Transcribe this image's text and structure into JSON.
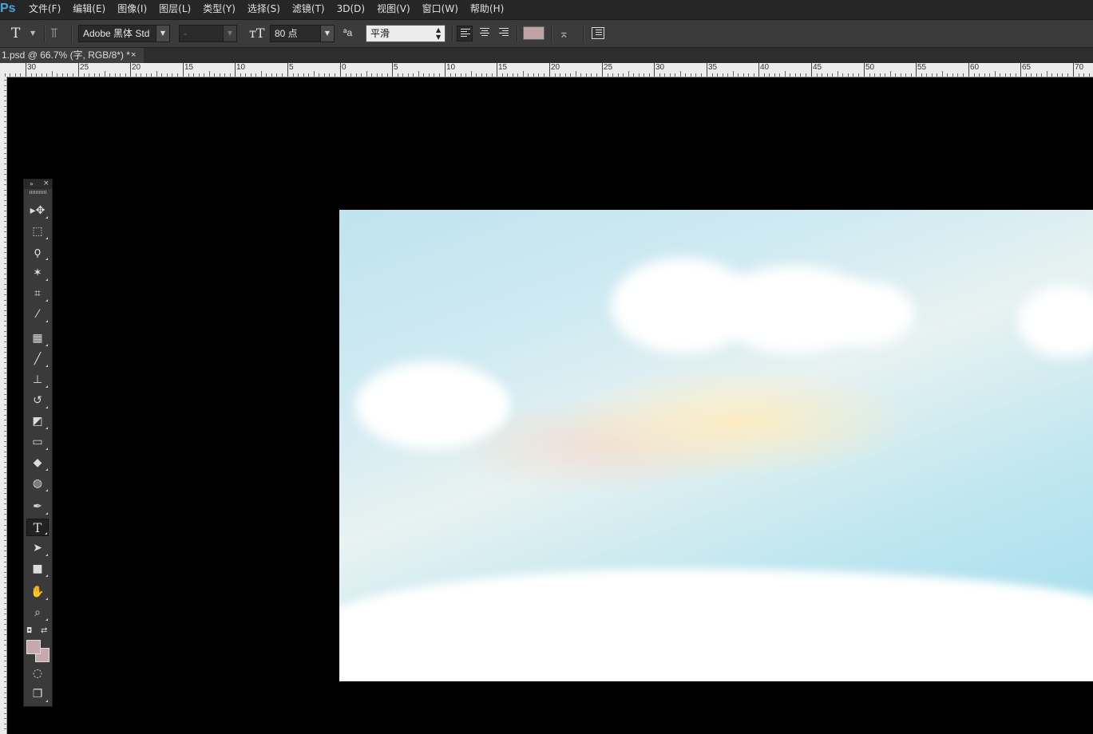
{
  "app": {
    "logo": "Ps"
  },
  "menu": [
    "文件(F)",
    "编辑(E)",
    "图像(I)",
    "图层(L)",
    "类型(Y)",
    "选择(S)",
    "滤镜(T)",
    "3D(D)",
    "视图(V)",
    "窗口(W)",
    "帮助(H)"
  ],
  "options": {
    "tool_glyph": "T",
    "font_family": "Adobe 黑体 Std",
    "font_style": "-",
    "font_size": "80 点",
    "aa_glyph": "ªa",
    "antialias": "平滑",
    "text_color": "#bfa2a6"
  },
  "document": {
    "tab_title": "1.psd @ 66.7% (字, RGB/8*) *",
    "close_glyph": "×"
  },
  "ruler": {
    "labels": [
      "30",
      "25",
      "20",
      "15",
      "10",
      "5",
      "0",
      "5",
      "10",
      "15",
      "20",
      "25",
      "30",
      "35",
      "40",
      "45",
      "50",
      "55",
      "60",
      "65",
      "70"
    ]
  },
  "tools": [
    {
      "name": "move-tool",
      "glyph": "▸✥"
    },
    {
      "name": "marquee-tool",
      "glyph": "⬚"
    },
    {
      "name": "lasso-tool",
      "glyph": "ϙ"
    },
    {
      "name": "magic-wand-tool",
      "glyph": "✶"
    },
    {
      "name": "crop-tool",
      "glyph": "⌗"
    },
    {
      "name": "eyedropper-tool",
      "glyph": "⁄"
    },
    {
      "name": "healing-brush-tool",
      "glyph": "▦"
    },
    {
      "name": "brush-tool",
      "glyph": "╱"
    },
    {
      "name": "clone-stamp-tool",
      "glyph": "⊥"
    },
    {
      "name": "history-brush-tool",
      "glyph": "↺"
    },
    {
      "name": "eraser-tool",
      "glyph": "◩"
    },
    {
      "name": "gradient-tool",
      "glyph": "▭"
    },
    {
      "name": "blur-tool",
      "glyph": "◆"
    },
    {
      "name": "dodge-tool",
      "glyph": "◍"
    },
    {
      "name": "pen-tool",
      "glyph": "✒"
    },
    {
      "name": "type-tool",
      "glyph": "T"
    },
    {
      "name": "path-selection-tool",
      "glyph": "➤"
    },
    {
      "name": "rectangle-tool",
      "glyph": "■"
    },
    {
      "name": "hand-tool",
      "glyph": "✋"
    },
    {
      "name": "zoom-tool",
      "glyph": "⌕"
    },
    {
      "name": "quick-mask-tool",
      "glyph": "◌"
    },
    {
      "name": "screen-mode-tool",
      "glyph": "❐"
    }
  ],
  "colors": {
    "foreground": "#c7a9ad",
    "background": "#c7a9ad"
  },
  "panel": {
    "expand_glyph": "»",
    "close_glyph": "×"
  }
}
